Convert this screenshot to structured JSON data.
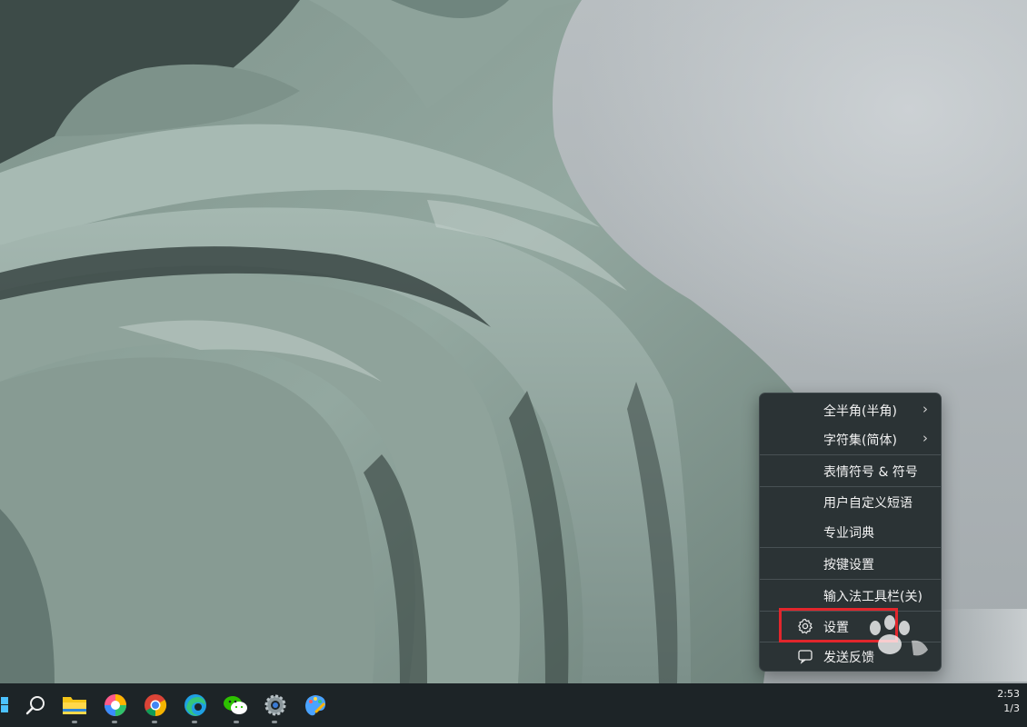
{
  "context_menu": {
    "items": [
      {
        "label": "全半角(半角)",
        "submenu": true
      },
      {
        "label": "字符集(简体)",
        "submenu": true
      },
      {
        "label": "表情符号 & 符号",
        "submenu": false
      },
      {
        "label": "用户自定义短语",
        "submenu": false
      },
      {
        "label": "专业词典",
        "submenu": false
      },
      {
        "label": "按键设置",
        "submenu": false
      },
      {
        "label": "输入法工具栏(关)",
        "submenu": false
      },
      {
        "label": "设置",
        "submenu": false,
        "icon": "gear-icon",
        "highlighted": true
      },
      {
        "label": "发送反馈",
        "submenu": false,
        "icon": "feedback-icon"
      }
    ],
    "chevron": "›",
    "highlight_color": "#e2262c"
  },
  "taskbar": {
    "icons": [
      "windows-start-icon",
      "search-icon",
      "file-explorer-icon",
      "photos-icon",
      "chrome-icon",
      "edge-icon",
      "wechat-icon",
      "settings-icon",
      "paint-icon"
    ],
    "clock_time": "2:53",
    "clock_date": "1/3"
  },
  "colors": {
    "menu_bg": "#2b3335",
    "taskbar_bg": "#1d2427",
    "wallpaper_green": "#8fa39b"
  }
}
